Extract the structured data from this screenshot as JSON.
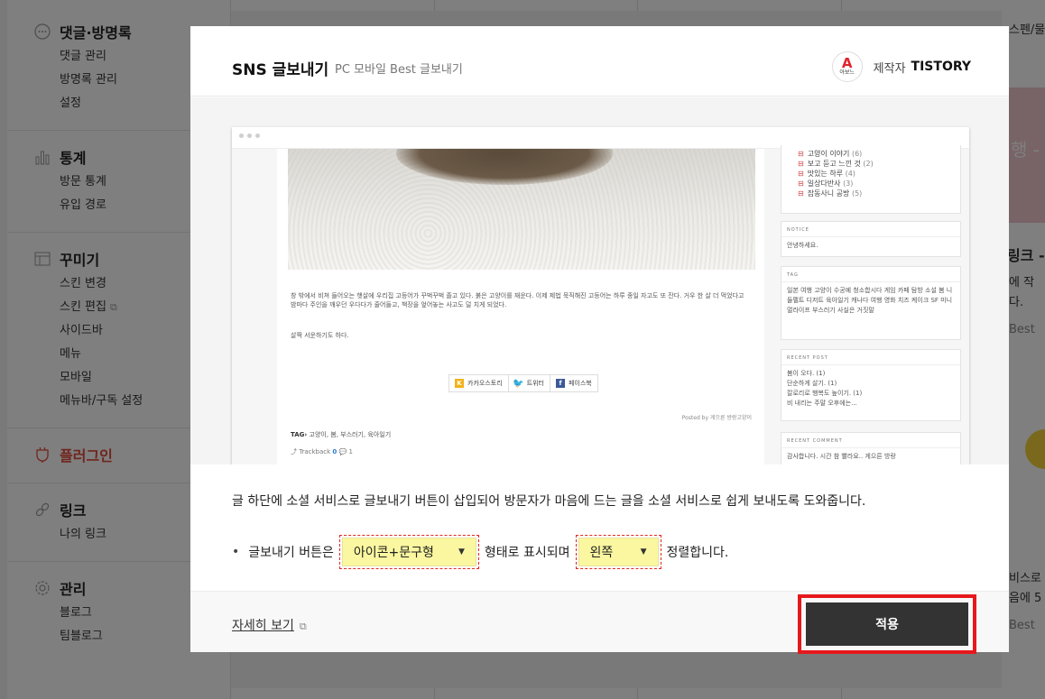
{
  "sidebar": {
    "groups": [
      {
        "title": "댓글·방명록",
        "items": [
          "댓글 관리",
          "방명록 관리",
          "설정"
        ]
      },
      {
        "title": "통계",
        "items": [
          "방문 통계",
          "유입 경로"
        ]
      },
      {
        "title": "꾸미기",
        "items": [
          "스킨 변경",
          "스킨 편집",
          "사이드바",
          "메뉴",
          "모바일",
          "메뉴바/구독 설정"
        ]
      },
      {
        "title": "플러그인",
        "items": []
      },
      {
        "title": "링크",
        "items": [
          "나의 링크"
        ]
      },
      {
        "title": "관리",
        "items": [
          "블로그",
          "팀블로그"
        ]
      }
    ]
  },
  "background_right": {
    "t1": "스펜/물",
    "t2": "행 -",
    "t3": "링크 -",
    "t4": "에 작",
    "t5": "다.",
    "t6": "Best",
    "t7": "비스로",
    "t8": "음에 5",
    "t9": "Best"
  },
  "modal": {
    "title": "SNS 글보내기",
    "subtitle": "PC 모바일 Best 글보내기",
    "maker_logo_letter": "A",
    "maker_logo_sub": "아보느",
    "maker_label": "제작자",
    "maker_name": "TISTORY",
    "description": "글 하단에 소셜 서비스로 글보내기 버튼이 삽입되어 방문자가 마음에 드는 글을 소셜 서비스로 쉽게 보내도록 도와줍니다.",
    "option": {
      "bullet": "•",
      "prefix": "글보내기 버튼은",
      "style_select": "아이콘+문구형",
      "middle": "형태로 표시되며",
      "align_select": "왼쪽",
      "suffix": "정렬합니다."
    },
    "footer": {
      "more_link": "자세히 보기",
      "apply": "적용"
    }
  },
  "preview": {
    "post_text_1": "창 밖에서 비쳐 들어오는 햇살에 우리집 고등어가 꾸벅꾸벅 졸고 있다. 붉은 고양이를 재운다. 이제 제법 묵직해진 고등어는 하루 종일 자고도 또 잔다. 거우 한 살 더 먹었다고 밤마다 주인을 깨우던 우다다가 줄어들고, 책장을 엎어놓는 사고도 덜 치게 되었다.",
    "post_text_2": "살짝 서운하기도 하다.",
    "share_kakao": "카카오스토리",
    "share_twitter": "트위터",
    "share_facebook": "페이스북",
    "posted_by": "Posted by 게으른 방랑고양이",
    "tag_label": "TAG›",
    "tags": "고양이, 봄, 부스러기, 육아일기",
    "trackback_label": "Trackback",
    "trackback_count": "0",
    "comment_count": "1",
    "categories": [
      {
        "name": "고양이 이야기",
        "count": "(6)"
      },
      {
        "name": "보고 듣고 느낀 것",
        "count": "(2)"
      },
      {
        "name": "맛있는 하루",
        "count": "(4)"
      },
      {
        "name": "일상다반사",
        "count": "(3)"
      },
      {
        "name": "잡동사니 공방",
        "count": "(5)"
      }
    ],
    "notice_head": "NOTICE",
    "notice_body": "안녕하세요.",
    "tag_head": "TAG",
    "tag_body": "일본 여행 고양이 수공예 청소합시다 게임 카페 탐방 소설 봄 니들펠트 디저트 육아일기 캐나다 여행 영화 치즈 케이크 SF 미니멀라이프 부스러기 사실은 거짓말",
    "recent_post_head": "RECENT POST",
    "recent_posts": [
      "봄이 오다. (1)",
      "단순하게 살기. (1)",
      "칼로리로 행복도 높이기. (1)",
      "비 내리는 주말 오후에는..."
    ],
    "recent_comment_head": "RECENT COMMENT",
    "recent_comment": "감사합니다. 시간 참 빨라요.. 게으른 방랑"
  },
  "colors": {
    "accent_red": "#e6181c",
    "select_yellow": "#fbf7a0",
    "apply_bg": "#333333"
  }
}
